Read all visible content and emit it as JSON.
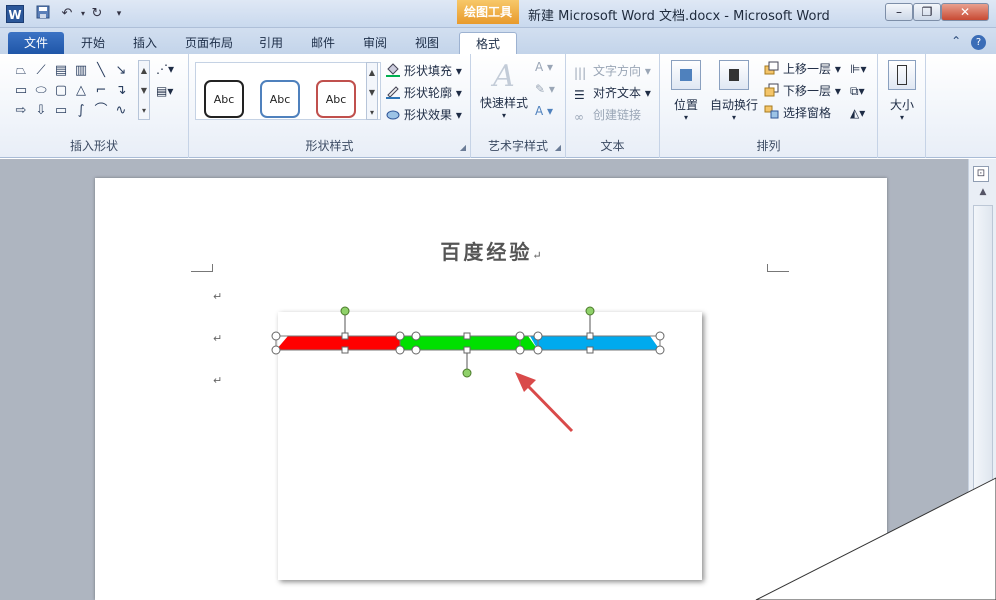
{
  "titlebar": {
    "app_icon": "W",
    "contextual_tab": "绘图工具",
    "title": "新建 Microsoft Word 文档.docx - Microsoft Word",
    "qat": {
      "save": "save-icon",
      "undo": "undo-icon",
      "redo": "redo-icon",
      "customize": "dropdown-icon"
    },
    "controls": {
      "minimize": "–",
      "restore": "❐",
      "close": "✕"
    }
  },
  "tabs": [
    {
      "label": "文件"
    },
    {
      "label": "开始"
    },
    {
      "label": "插入"
    },
    {
      "label": "页面布局"
    },
    {
      "label": "引用"
    },
    {
      "label": "邮件"
    },
    {
      "label": "审阅"
    },
    {
      "label": "视图"
    },
    {
      "label": "格式"
    }
  ],
  "ribbon": {
    "insert_shapes": {
      "label": "插入形状"
    },
    "shape_styles": {
      "label": "形状样式",
      "samples": [
        "Abc",
        "Abc",
        "Abc"
      ],
      "fill": "形状填充",
      "outline": "形状轮廓",
      "effects": "形状效果"
    },
    "wordart": {
      "label": "艺术字样式",
      "quick_styles": "快速样式"
    },
    "text": {
      "label": "文本",
      "direction": "文字方向",
      "align": "对齐文本",
      "link": "创建链接"
    },
    "arrange": {
      "label": "排列",
      "position": "位置",
      "wrap": "自动换行",
      "bring_forward": "上移一层",
      "send_backward": "下移一层",
      "selection_pane": "选择窗格"
    },
    "size": {
      "label": "大小"
    }
  },
  "document": {
    "heading": "百度经验",
    "paragraph_mark": "↵",
    "bar_colors": [
      "#ff0000",
      "#00e000",
      "#00aaee"
    ],
    "arrow_color": "#d94a4a"
  }
}
